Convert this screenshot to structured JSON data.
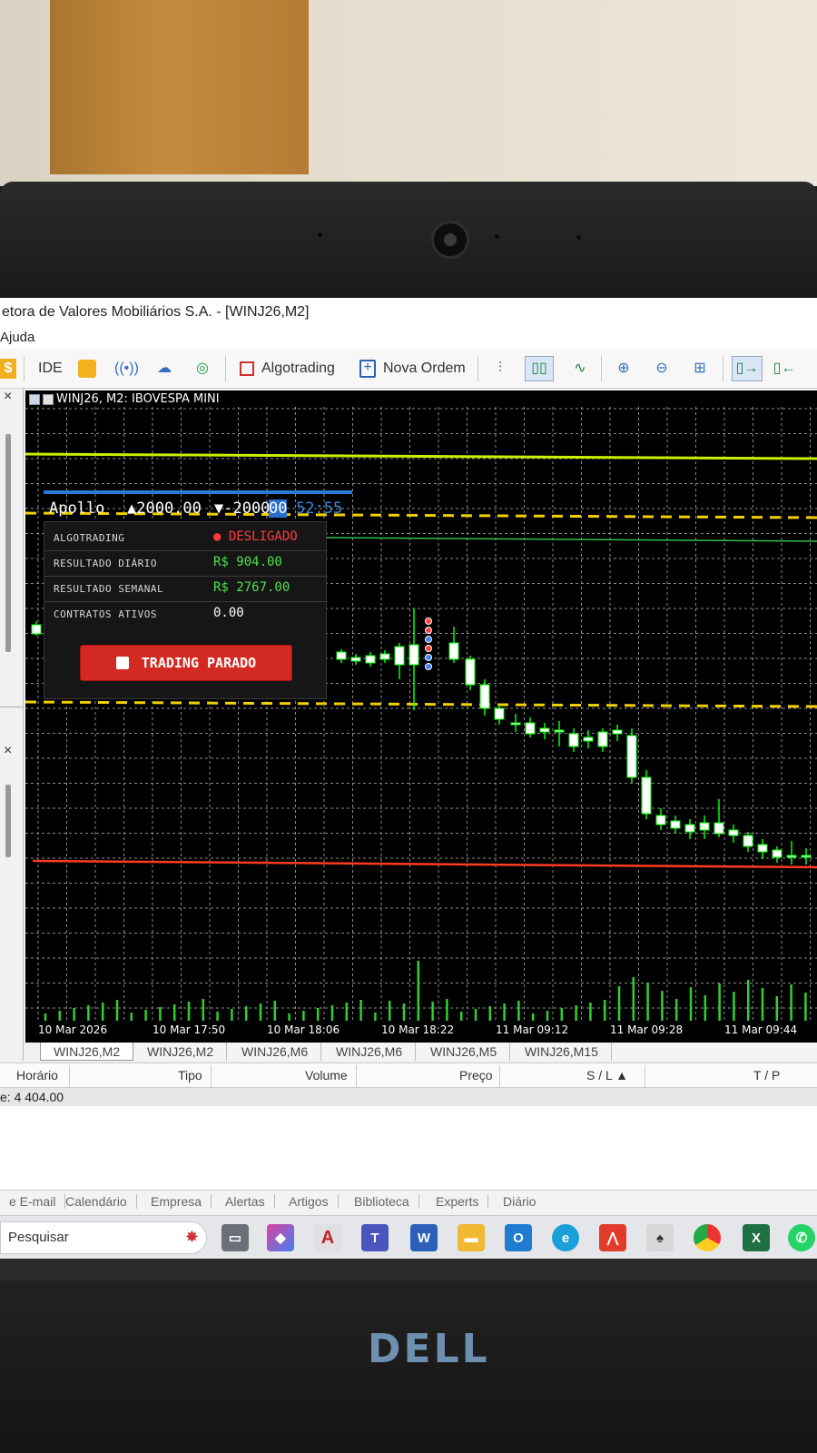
{
  "window": {
    "title": "etora de Valores Mobiliários S.A. - [WINJ26,M2]",
    "menu": "Ajuda"
  },
  "toolbar": {
    "ide_label": "IDE",
    "algotrading_label": "Algotrading",
    "nova_ordem_label": "Nova Ordem"
  },
  "chart": {
    "title": "WINJ26, M2:  IBOVESPA MINI",
    "x_labels": [
      "10 Mar 2026",
      "10 Mar 17:50",
      "10 Mar 18:06",
      "10 Mar 18:22",
      "11 Mar 09:12",
      "11 Mar 09:28",
      "11 Mar 09:44"
    ],
    "colors": {
      "background": "#000000",
      "grid": "#8a8a8a",
      "bull": "#ffffff",
      "bear": "#00ff00",
      "volume": "#2fd12f",
      "line_yellow_green": "#c8f000",
      "line_dashed_yellow": "#f0d000",
      "line_red": "#ff3b1f",
      "line_green": "#2fbf4f"
    }
  },
  "apollo": {
    "name": "Apollo",
    "buy": "▲2000.00",
    "sell": "▼-2000",
    "time_a": "00",
    "time_b": "52:55",
    "rows": [
      {
        "label": "ALGOTRADING",
        "value": "● DESLIGADO",
        "color": "#ff3b3b"
      },
      {
        "label": "RESULTADO DIÁRIO",
        "value": "R$ 904.00",
        "color": "#4fe04f"
      },
      {
        "label": "RESULTADO SEMANAL",
        "value": "R$ 2767.00",
        "color": "#4fe04f"
      },
      {
        "label": "CONTRATOS ATIVOS",
        "value": "0.00",
        "color": "#ffffff"
      }
    ],
    "button_label": "TRADING PARADO"
  },
  "chart_tabs": [
    "WINJ26,M2",
    "WINJ26,M2",
    "WINJ26,M6",
    "WINJ26,M6",
    "WINJ26,M5",
    "WINJ26,M15"
  ],
  "trade_table": {
    "headers": [
      "Horário",
      "Tipo",
      "Volume",
      "Preço",
      "S / L  ▲",
      "T / P"
    ],
    "balance": "e: 4 404.00"
  },
  "bottom_tabs": [
    "e E-mail",
    "Calendário",
    "Empresa",
    "Alertas",
    "Artigos",
    "Biblioteca",
    "Experts",
    "Diário"
  ],
  "taskbar": {
    "search_placeholder": "Pesquisar"
  },
  "brand": "DELL"
}
